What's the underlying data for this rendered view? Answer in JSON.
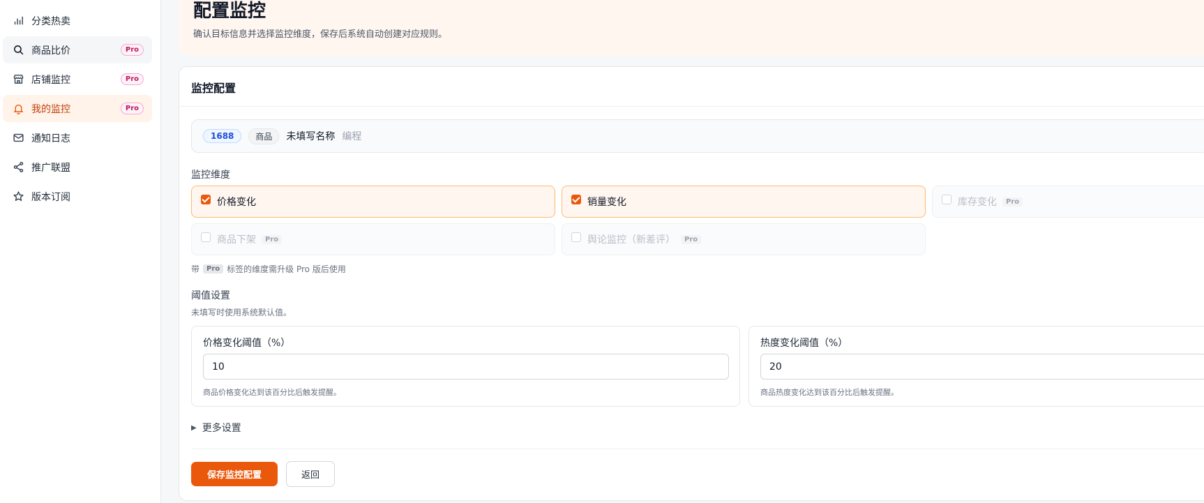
{
  "sidebar": {
    "items": [
      {
        "label": "分类热卖",
        "icon": "bar-chart-icon",
        "pro": false
      },
      {
        "label": "商品比价",
        "icon": "search-icon",
        "pro": true
      },
      {
        "label": "店铺监控",
        "icon": "store-icon",
        "pro": true
      },
      {
        "label": "我的监控",
        "icon": "bell-icon",
        "pro": true,
        "active": true
      },
      {
        "label": "通知日志",
        "icon": "mail-icon",
        "pro": false
      },
      {
        "label": "推广联盟",
        "icon": "share-icon",
        "pro": false
      },
      {
        "label": "版本订阅",
        "icon": "star-icon",
        "pro": false
      }
    ],
    "pro_label": "Pro"
  },
  "header": {
    "title": "配置监控",
    "subtitle": "确认目标信息并选择监控维度，保存后系统自动创建对应规则。"
  },
  "card": {
    "title": "监控配置",
    "target": {
      "platform": "1688",
      "type": "商品",
      "name": "未填写名称",
      "category": "编程"
    },
    "dimensions_label": "监控维度",
    "dimensions": [
      {
        "label": "价格变化",
        "checked": true,
        "disabled": false,
        "pro": false
      },
      {
        "label": "销量变化",
        "checked": true,
        "disabled": false,
        "pro": false
      },
      {
        "label": "库存变化",
        "checked": false,
        "disabled": true,
        "pro": true
      },
      {
        "label": "商品下架",
        "checked": false,
        "disabled": true,
        "pro": true
      },
      {
        "label": "舆论监控（新差评）",
        "checked": false,
        "disabled": true,
        "pro": true
      }
    ],
    "hint_prefix": "带",
    "hint_suffix": "标签的维度需升级 Pro 版后使用",
    "threshold_label": "阈值设置",
    "threshold_sub": "未填写时使用系统默认值。",
    "thresholds": [
      {
        "label": "价格变化阈值（%）",
        "value": "10",
        "help": "商品价格变化达到该百分比后触发提醒。"
      },
      {
        "label": "热度变化阈值（%）",
        "value": "20",
        "help": "商品热度变化达到该百分比后触发提醒。"
      }
    ],
    "more_settings": "更多设置",
    "save_label": "保存监控配置",
    "back_label": "返回"
  },
  "colors": {
    "accent": "#ea580c",
    "active_bg": "#fff3ea",
    "pro": "#be185d"
  }
}
